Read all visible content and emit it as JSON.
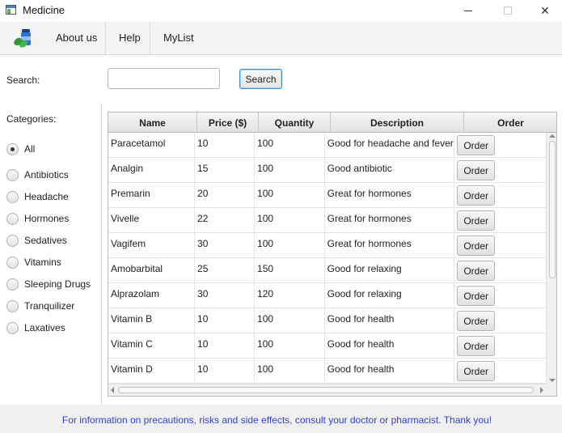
{
  "window": {
    "title": "Medicine"
  },
  "menu": {
    "logo_icon": "pill-bottle-leaf-icon",
    "items": [
      {
        "label": "About us"
      },
      {
        "label": "Help"
      },
      {
        "label": "MyList"
      }
    ]
  },
  "search": {
    "label": "Search:",
    "value": "",
    "placeholder": "",
    "button_label": "Search"
  },
  "categories": {
    "label": "Categories:",
    "selected": "All",
    "items": [
      {
        "label": "All",
        "checked": true
      },
      {
        "label": "Antibiotics",
        "checked": false
      },
      {
        "label": "Headache",
        "checked": false
      },
      {
        "label": "Hormones",
        "checked": false
      },
      {
        "label": "Sedatives",
        "checked": false
      },
      {
        "label": "Vitamins",
        "checked": false
      },
      {
        "label": "Sleeping Drugs",
        "checked": false
      },
      {
        "label": "Tranquilizer",
        "checked": false
      },
      {
        "label": "Laxatives",
        "checked": false
      }
    ]
  },
  "table": {
    "columns": [
      "Name",
      "Price ($)",
      "Quantity",
      "Description",
      "Order"
    ],
    "order_button_label": "Order",
    "rows": [
      {
        "name": "Paracetamol",
        "price": "10",
        "quantity": "100",
        "description": "Good for headache and fever"
      },
      {
        "name": "Analgin",
        "price": "15",
        "quantity": "100",
        "description": "Good antibiotic"
      },
      {
        "name": "Premarin",
        "price": "20",
        "quantity": "100",
        "description": "Great for hormones"
      },
      {
        "name": "Vivelle",
        "price": "22",
        "quantity": "100",
        "description": "Great for hormones"
      },
      {
        "name": "Vagifem",
        "price": "30",
        "quantity": "100",
        "description": "Great for hormones"
      },
      {
        "name": "Amobarbital",
        "price": "25",
        "quantity": "150",
        "description": "Good for relaxing"
      },
      {
        "name": "Alprazolam",
        "price": "30",
        "quantity": "120",
        "description": "Good for relaxing"
      },
      {
        "name": "Vitamin B",
        "price": "10",
        "quantity": "100",
        "description": "Good for health"
      },
      {
        "name": "Vitamin C",
        "price": "10",
        "quantity": "100",
        "description": "Good for health"
      },
      {
        "name": "Vitamin D",
        "price": "10",
        "quantity": "100",
        "description": "Good for health"
      }
    ]
  },
  "footer": {
    "text": "For information on precautions, risks and side effects, consult your doctor or pharmacist. Thank you!"
  },
  "colors": {
    "footer_text": "#3b3bcc",
    "search_focus_border": "#3d8fd1"
  }
}
